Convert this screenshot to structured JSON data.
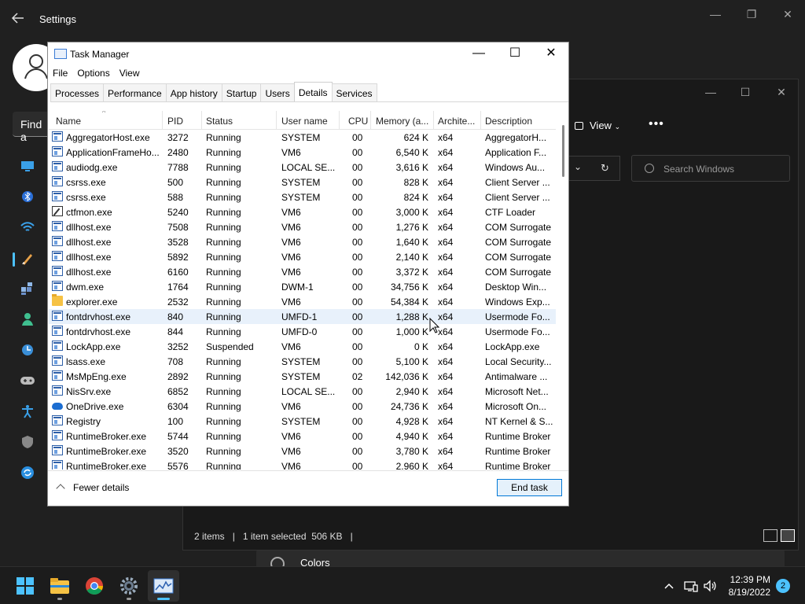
{
  "settings": {
    "title": "Settings",
    "find_placeholder": "Find a"
  },
  "settings_page": {
    "colors_label": "Colors"
  },
  "explorer": {
    "view_label": "View",
    "more_label": "•••",
    "search_placeholder": "Search Windows",
    "status_items": "2 items",
    "status_selected": "1 item selected  506 KB"
  },
  "task_manager": {
    "title": "Task Manager",
    "menu": [
      "File",
      "Options",
      "View"
    ],
    "tabs": [
      "Processes",
      "Performance",
      "App history",
      "Startup",
      "Users",
      "Details",
      "Services"
    ],
    "active_tab": "Details",
    "columns": [
      "Name",
      "PID",
      "Status",
      "User name",
      "CPU",
      "Memory (a...",
      "Archite...",
      "Description"
    ],
    "rows": [
      {
        "icon": "exe",
        "name": "AggregatorHost.exe",
        "pid": "3272",
        "status": "Running",
        "user": "SYSTEM",
        "cpu": "00",
        "mem": "624 K",
        "arch": "x64",
        "desc": "AggregatorH..."
      },
      {
        "icon": "exe",
        "name": "ApplicationFrameHo...",
        "pid": "2480",
        "status": "Running",
        "user": "VM6",
        "cpu": "00",
        "mem": "6,540 K",
        "arch": "x64",
        "desc": "Application F..."
      },
      {
        "icon": "exe",
        "name": "audiodg.exe",
        "pid": "7788",
        "status": "Running",
        "user": "LOCAL SE...",
        "cpu": "00",
        "mem": "3,616 K",
        "arch": "x64",
        "desc": "Windows Au..."
      },
      {
        "icon": "exe",
        "name": "csrss.exe",
        "pid": "500",
        "status": "Running",
        "user": "SYSTEM",
        "cpu": "00",
        "mem": "828 K",
        "arch": "x64",
        "desc": "Client Server ..."
      },
      {
        "icon": "exe",
        "name": "csrss.exe",
        "pid": "588",
        "status": "Running",
        "user": "SYSTEM",
        "cpu": "00",
        "mem": "824 K",
        "arch": "x64",
        "desc": "Client Server ..."
      },
      {
        "icon": "pen",
        "name": "ctfmon.exe",
        "pid": "5240",
        "status": "Running",
        "user": "VM6",
        "cpu": "00",
        "mem": "3,000 K",
        "arch": "x64",
        "desc": "CTF Loader"
      },
      {
        "icon": "exe",
        "name": "dllhost.exe",
        "pid": "7508",
        "status": "Running",
        "user": "VM6",
        "cpu": "00",
        "mem": "1,276 K",
        "arch": "x64",
        "desc": "COM Surrogate"
      },
      {
        "icon": "exe",
        "name": "dllhost.exe",
        "pid": "3528",
        "status": "Running",
        "user": "VM6",
        "cpu": "00",
        "mem": "1,640 K",
        "arch": "x64",
        "desc": "COM Surrogate"
      },
      {
        "icon": "exe",
        "name": "dllhost.exe",
        "pid": "5892",
        "status": "Running",
        "user": "VM6",
        "cpu": "00",
        "mem": "2,140 K",
        "arch": "x64",
        "desc": "COM Surrogate"
      },
      {
        "icon": "exe",
        "name": "dllhost.exe",
        "pid": "6160",
        "status": "Running",
        "user": "VM6",
        "cpu": "00",
        "mem": "3,372 K",
        "arch": "x64",
        "desc": "COM Surrogate"
      },
      {
        "icon": "exe",
        "name": "dwm.exe",
        "pid": "1764",
        "status": "Running",
        "user": "DWM-1",
        "cpu": "00",
        "mem": "34,756 K",
        "arch": "x64",
        "desc": "Desktop Win..."
      },
      {
        "icon": "folder",
        "name": "explorer.exe",
        "pid": "2532",
        "status": "Running",
        "user": "VM6",
        "cpu": "00",
        "mem": "54,384 K",
        "arch": "x64",
        "desc": "Windows Exp..."
      },
      {
        "icon": "exe",
        "name": "fontdrvhost.exe",
        "pid": "840",
        "status": "Running",
        "user": "UMFD-1",
        "cpu": "00",
        "mem": "1,288 K",
        "arch": "x64",
        "desc": "Usermode Fo...",
        "selected": true
      },
      {
        "icon": "exe",
        "name": "fontdrvhost.exe",
        "pid": "844",
        "status": "Running",
        "user": "UMFD-0",
        "cpu": "00",
        "mem": "1,000 K",
        "arch": "x64",
        "desc": "Usermode Fo..."
      },
      {
        "icon": "exe",
        "name": "LockApp.exe",
        "pid": "3252",
        "status": "Suspended",
        "user": "VM6",
        "cpu": "00",
        "mem": "0 K",
        "arch": "x64",
        "desc": "LockApp.exe"
      },
      {
        "icon": "exe",
        "name": "lsass.exe",
        "pid": "708",
        "status": "Running",
        "user": "SYSTEM",
        "cpu": "00",
        "mem": "5,100 K",
        "arch": "x64",
        "desc": "Local Security..."
      },
      {
        "icon": "exe",
        "name": "MsMpEng.exe",
        "pid": "2892",
        "status": "Running",
        "user": "SYSTEM",
        "cpu": "02",
        "mem": "142,036 K",
        "arch": "x64",
        "desc": "Antimalware ..."
      },
      {
        "icon": "exe",
        "name": "NisSrv.exe",
        "pid": "6852",
        "status": "Running",
        "user": "LOCAL SE...",
        "cpu": "00",
        "mem": "2,940 K",
        "arch": "x64",
        "desc": "Microsoft Net..."
      },
      {
        "icon": "cloud",
        "name": "OneDrive.exe",
        "pid": "6304",
        "status": "Running",
        "user": "VM6",
        "cpu": "00",
        "mem": "24,736 K",
        "arch": "x64",
        "desc": "Microsoft On..."
      },
      {
        "icon": "exe",
        "name": "Registry",
        "pid": "100",
        "status": "Running",
        "user": "SYSTEM",
        "cpu": "00",
        "mem": "4,928 K",
        "arch": "x64",
        "desc": "NT Kernel & S..."
      },
      {
        "icon": "exe",
        "name": "RuntimeBroker.exe",
        "pid": "5744",
        "status": "Running",
        "user": "VM6",
        "cpu": "00",
        "mem": "4,940 K",
        "arch": "x64",
        "desc": "Runtime Broker"
      },
      {
        "icon": "exe",
        "name": "RuntimeBroker.exe",
        "pid": "3520",
        "status": "Running",
        "user": "VM6",
        "cpu": "00",
        "mem": "3,780 K",
        "arch": "x64",
        "desc": "Runtime Broker"
      },
      {
        "icon": "exe",
        "name": "RuntimeBroker.exe",
        "pid": "5576",
        "status": "Running",
        "user": "VM6",
        "cpu": "00",
        "mem": "2,960 K",
        "arch": "x64",
        "desc": "Runtime Broker"
      }
    ],
    "fewer_details": "Fewer details",
    "end_task": "End task"
  },
  "taskbar": {
    "time": "12:39 PM",
    "date": "8/19/2022",
    "notification_count": "2",
    "apps": [
      "start-icon",
      "file-explorer-icon",
      "chrome-icon",
      "settings-icon",
      "task-manager-icon"
    ]
  },
  "colors": {
    "accent": "#0078d7",
    "accent_light": "#4cc2ff",
    "selected_row": "#e8f1fb"
  }
}
